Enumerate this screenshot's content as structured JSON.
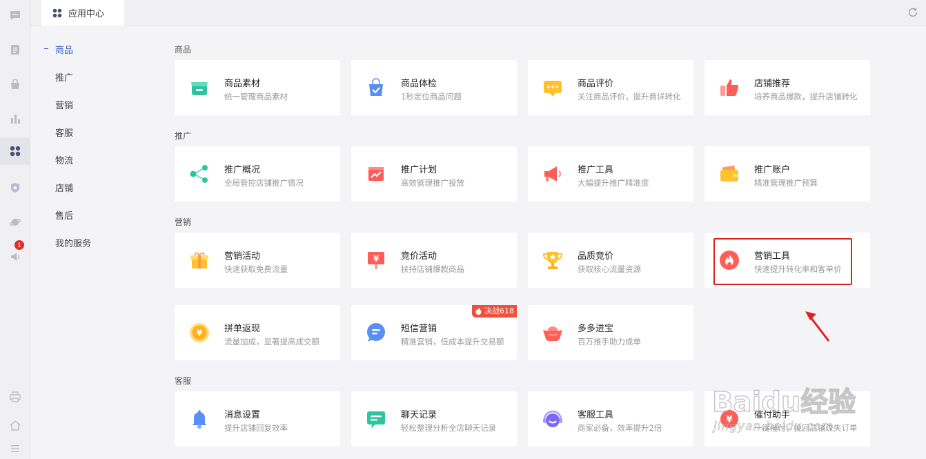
{
  "tab": {
    "label": "应用中心"
  },
  "subnav": [
    "商品",
    "推广",
    "营销",
    "客服",
    "物流",
    "店铺",
    "售后",
    "我的服务"
  ],
  "rail": {
    "badge": "1"
  },
  "sections": [
    {
      "title": "商品",
      "cards": [
        {
          "title": "商品素材",
          "desc": "统一管理商品素材",
          "icon": "store-icon"
        },
        {
          "title": "商品体检",
          "desc": "1秒定位商品问题",
          "icon": "bag-check-icon"
        },
        {
          "title": "商品评价",
          "desc": "关注商品评价，提升商详转化",
          "icon": "comment-icon"
        },
        {
          "title": "店铺推荐",
          "desc": "培养商品爆款，提升店铺转化",
          "icon": "thumbs-up-icon"
        }
      ]
    },
    {
      "title": "推广",
      "cards": [
        {
          "title": "推广概况",
          "desc": "全局管控店铺推广情况",
          "icon": "share-icon"
        },
        {
          "title": "推广计划",
          "desc": "高效管理推广投放",
          "icon": "trend-icon"
        },
        {
          "title": "推广工具",
          "desc": "大幅提升推广精准度",
          "icon": "megaphone-icon"
        },
        {
          "title": "推广账户",
          "desc": "精准管理推广预算",
          "icon": "wallet-icon"
        }
      ]
    },
    {
      "title": "营销",
      "cards": [
        {
          "title": "营销活动",
          "desc": "快速获取免费流量",
          "icon": "gift-icon"
        },
        {
          "title": "竞价活动",
          "desc": "扶持店铺爆款商品",
          "icon": "yen-flag-icon"
        },
        {
          "title": "品质竞价",
          "desc": "获取核心流量资源",
          "icon": "trophy-icon"
        },
        {
          "title": "营销工具",
          "desc": "快速提升转化率和客单价",
          "icon": "flame-icon"
        },
        {
          "title": "拼单返现",
          "desc": "流量加成，显著提高成交额",
          "icon": "coin-icon"
        },
        {
          "title": "短信营销",
          "desc": "精准营销，低成本提升交易额",
          "icon": "message-icon",
          "badge": "决战618"
        },
        {
          "title": "多多进宝",
          "desc": "百万推手助力成单",
          "icon": "ingot-icon"
        }
      ]
    },
    {
      "title": "客服",
      "cards": [
        {
          "title": "消息设置",
          "desc": "提升店铺回复效率",
          "icon": "bell-icon"
        },
        {
          "title": "聊天记录",
          "desc": "轻松整理分析全店聊天记录",
          "icon": "chat-record-icon"
        },
        {
          "title": "客服工具",
          "desc": "商家必备，效率提升2倍",
          "icon": "service-icon"
        },
        {
          "title": "催付助手",
          "desc": "一键催付，挽回店铺流失订单",
          "icon": "payment-icon"
        }
      ]
    }
  ],
  "watermark": {
    "brand": "Baidu经验",
    "url": "jingyan.baidu.com"
  },
  "colors": {
    "accent": "#3a62c7",
    "highlight": "#e02020",
    "badge": "#f04f3c"
  }
}
